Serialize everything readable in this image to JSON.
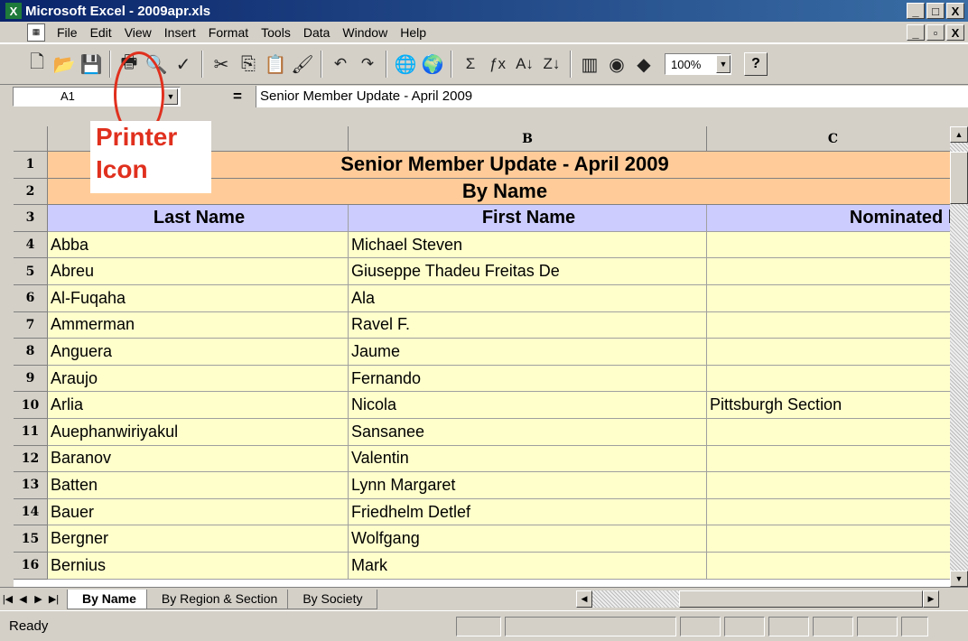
{
  "window": {
    "app_icon_glyph": "X",
    "title": "Microsoft Excel - 2009apr.xls",
    "controls": [
      "_",
      "□",
      "X"
    ]
  },
  "menubar": {
    "items": [
      {
        "label": "File"
      },
      {
        "label": "Edit"
      },
      {
        "label": "View"
      },
      {
        "label": "Insert"
      },
      {
        "label": "Format"
      },
      {
        "label": "Tools"
      },
      {
        "label": "Data"
      },
      {
        "label": "Window"
      },
      {
        "label": "Help"
      }
    ],
    "doc_controls": [
      "_",
      "▫",
      "X"
    ]
  },
  "toolbar": {
    "buttons": [
      {
        "icon": "new-icon",
        "glyph": "🗋"
      },
      {
        "icon": "open-icon",
        "glyph": "📂"
      },
      {
        "icon": "save-icon",
        "glyph": "💾"
      },
      {
        "icon": "print-icon",
        "glyph": "🖶"
      },
      {
        "icon": "print-preview-icon",
        "glyph": "🔍"
      },
      {
        "icon": "spelling-icon",
        "glyph": "✓"
      },
      {
        "icon": "cut-icon",
        "glyph": "✂"
      },
      {
        "icon": "copy-icon",
        "glyph": "⎘"
      },
      {
        "icon": "paste-icon",
        "glyph": "📋"
      },
      {
        "icon": "format-painter-icon",
        "glyph": "🖌"
      },
      {
        "icon": "undo-icon",
        "glyph": "↶"
      },
      {
        "icon": "redo-icon",
        "glyph": "↷"
      },
      {
        "icon": "hyperlink-icon",
        "glyph": "🌐"
      },
      {
        "icon": "web-toolbar-icon",
        "glyph": "🌍"
      },
      {
        "icon": "autosum-icon",
        "glyph": "Σ"
      },
      {
        "icon": "function-icon",
        "glyph": "ƒx"
      },
      {
        "icon": "sort-ascending-icon",
        "glyph": "A↓"
      },
      {
        "icon": "sort-descending-icon",
        "glyph": "Z↓"
      },
      {
        "icon": "chart-wizard-icon",
        "glyph": "▥"
      },
      {
        "icon": "map-icon",
        "glyph": "◉"
      },
      {
        "icon": "drawing-icon",
        "glyph": "◆"
      }
    ],
    "zoom": "100%",
    "help_glyph": "?"
  },
  "formula_bar": {
    "cell_ref": "A1",
    "equals": "=",
    "content": "Senior Member Update - April 2009"
  },
  "sheet": {
    "columns": [
      {
        "id": "A",
        "label": ""
      },
      {
        "id": "B",
        "label": "B"
      },
      {
        "id": "C",
        "label": "C"
      }
    ],
    "title_row": {
      "num": "1",
      "text": "Senior Member Update - April 2009"
    },
    "subtitle_row": {
      "num": "2",
      "text": "By Name"
    },
    "header_row": {
      "num": "3",
      "cells": [
        "Last Name",
        "First Name",
        "Nominated b"
      ]
    },
    "rows": [
      {
        "num": "4",
        "cells": [
          "Abba",
          "Michael Steven",
          ""
        ]
      },
      {
        "num": "5",
        "cells": [
          "Abreu",
          "Giuseppe Thadeu Freitas De",
          ""
        ]
      },
      {
        "num": "6",
        "cells": [
          "Al-Fuqaha",
          "Ala",
          ""
        ]
      },
      {
        "num": "7",
        "cells": [
          "Ammerman",
          "Ravel F.",
          ""
        ]
      },
      {
        "num": "8",
        "cells": [
          "Anguera",
          "Jaume",
          ""
        ]
      },
      {
        "num": "9",
        "cells": [
          "Araujo",
          "Fernando",
          ""
        ]
      },
      {
        "num": "10",
        "cells": [
          "Arlia",
          "Nicola",
          "Pittsburgh Section"
        ]
      },
      {
        "num": "11",
        "cells": [
          "Auephanwiriyakul",
          "Sansanee",
          ""
        ]
      },
      {
        "num": "12",
        "cells": [
          "Baranov",
          "Valentin",
          ""
        ]
      },
      {
        "num": "13",
        "cells": [
          "Batten",
          "Lynn Margaret",
          ""
        ]
      },
      {
        "num": "14",
        "cells": [
          "Bauer",
          "Friedhelm Detlef",
          ""
        ]
      },
      {
        "num": "15",
        "cells": [
          "Bergner",
          "Wolfgang",
          ""
        ]
      },
      {
        "num": "16",
        "cells": [
          "Bernius",
          "Mark",
          ""
        ]
      }
    ],
    "tabs": [
      {
        "label": "By Name",
        "active": true
      },
      {
        "label": "By Region  & Section",
        "active": false
      },
      {
        "label": "By Society",
        "active": false
      }
    ]
  },
  "status": {
    "text": "Ready"
  },
  "annotation": {
    "label_line1": "Printer",
    "label_line2": "Icon",
    "color": "#e0301e"
  }
}
